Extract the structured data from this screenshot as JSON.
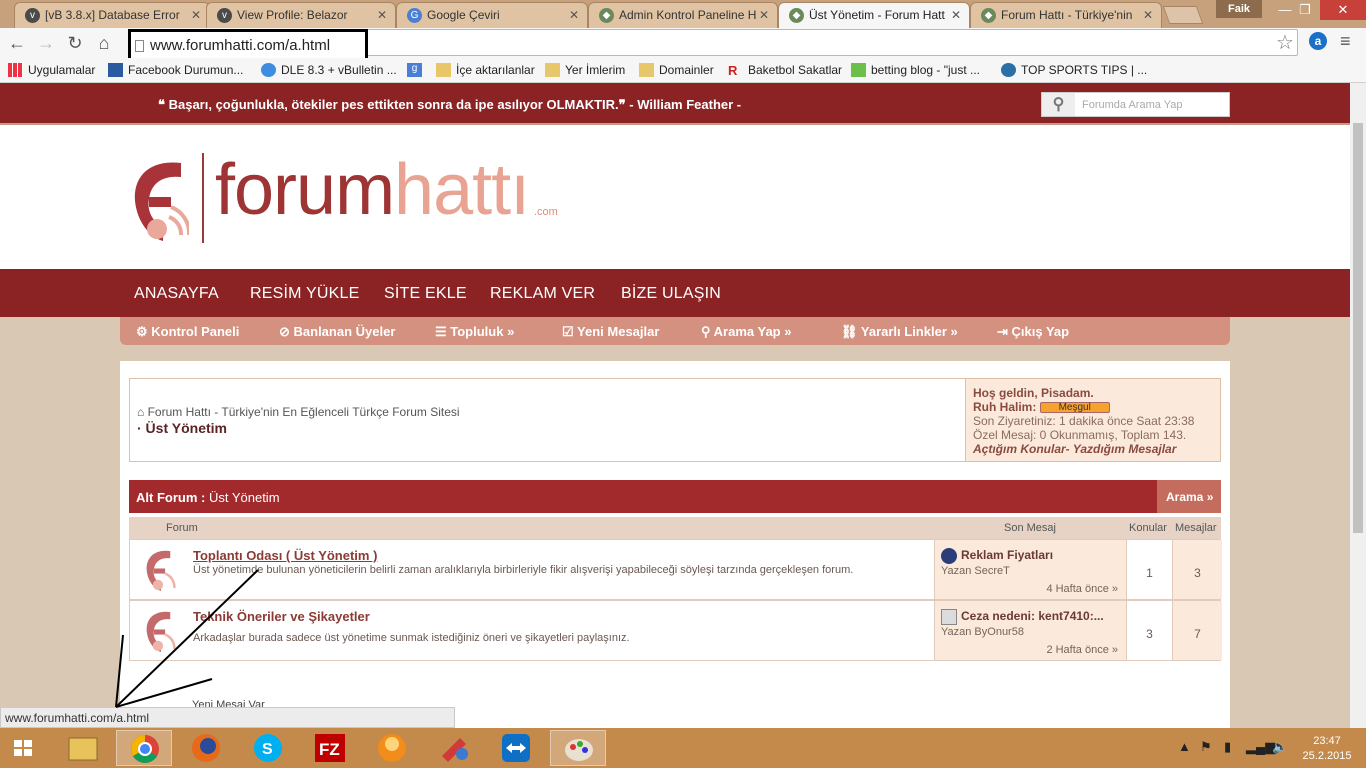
{
  "browser": {
    "tabs": [
      {
        "title": "[vB 3.8.x] Database Error",
        "active": false
      },
      {
        "title": "View Profile: Belazor",
        "active": false
      },
      {
        "title": "Google Çeviri",
        "active": false
      },
      {
        "title": "Admin Kontrol Paneline H",
        "active": false
      },
      {
        "title": "Üst Yönetim - Forum Hatt",
        "active": true
      },
      {
        "title": "Forum Hattı - Türkiye'nin",
        "active": false
      }
    ],
    "user_badge": "Faik",
    "url": "www.forumhatti.com/a.html",
    "bookmarks": [
      {
        "label": "Uygulamalar",
        "icon": "apps-grid-icon"
      },
      {
        "label": "Facebook Durumun...",
        "icon": "bookmark-page-icon"
      },
      {
        "label": "DLE 8.3 + vBulletin ...",
        "icon": "bookmark-page-icon"
      },
      {
        "label": "",
        "icon": "google-icon"
      },
      {
        "label": "İçe aktarılanlar",
        "icon": "folder-icon"
      },
      {
        "label": "Yer İmlerim",
        "icon": "folder-icon"
      },
      {
        "label": "Domainler",
        "icon": "folder-icon"
      },
      {
        "label": "Baketbol Sakatlar",
        "icon": "bookmark-page-icon"
      },
      {
        "label": "betting blog - \"just ...",
        "icon": "bookmark-page-icon"
      },
      {
        "label": "TOP SPORTS TIPS | ...",
        "icon": "wordpress-icon"
      }
    ],
    "status_url": "www.forumhatti.com/a.html"
  },
  "site": {
    "quote": "❝ Başarı, çoğunlukla, ötekiler pes ettikten sonra da ipe asılıyor OLMAKTIR.❞ - William Feather -",
    "search_placeholder": "Forumda Arama Yap",
    "logo_forum": "forum",
    "logo_hatti": "hattı",
    "logo_com": ".com",
    "main_nav": [
      "ANASAYFA",
      "RESİM YÜKLE",
      "SİTE EKLE",
      "REKLAM VER",
      "BİZE ULAŞIN"
    ],
    "sub_nav": [
      {
        "label": "⚙ Kontrol Paneli"
      },
      {
        "label": "⊘ Banlanan Üyeler"
      },
      {
        "label": "☰ Topluluk »"
      },
      {
        "label": "☑ Yeni Mesajlar"
      },
      {
        "label": "⚲ Arama Yap »"
      },
      {
        "label": "⛓ Yararlı Linkler »"
      },
      {
        "label": "⇥ Çıkış Yap"
      }
    ],
    "breadcrumb_root": "Forum Hattı - Türkiye'nin En Eğlenceli Türkçe Forum Sitesi",
    "breadcrumb_current": "· Üst Yönetim",
    "welcome": {
      "greeting": "Hoş geldin, Pisadam.",
      "mood_label": "Ruh Halim:",
      "mood_value": "Meşgul",
      "last_visit": "Son Ziyaretiniz: 1 dakika önce Saat 23:38",
      "pm": "Özel Mesaj: 0 Okunmamış, Toplam 143.",
      "links": "Açtığım Konular- Yazdığım Mesajlar"
    },
    "subforum_header_bold": "Alt Forum :",
    "subforum_header_name": "Üst Yönetim",
    "arama_label": "Arama »",
    "columns": {
      "forum": "Forum",
      "last_post": "Son Mesaj",
      "topics": "Konular",
      "posts": "Mesajlar"
    },
    "forums": [
      {
        "title": "Toplantı Odası ( Üst Yönetim )",
        "desc": "Üst yönetimde bulunan yöneticilerin belirli zaman aralıklarıyla birbirleriyle fikir alışverişi yapabileceği söyleşi tarzında gerçekleşen forum.",
        "last_title": "Reklam Fiyatları",
        "last_by": "Yazan SecreT",
        "last_ago": "4 Hafta önce »",
        "topics": "1",
        "posts": "3"
      },
      {
        "title": "Teknik Öneriler ve Şikayetler",
        "desc": "Arkadaşlar burada sadece üst yönetime sunmak istediğiniz öneri ve şikayetleri paylaşınız.",
        "last_title": "Ceza nedeni: kent7410:...",
        "last_by": "Yazan ByOnur58",
        "last_ago": "2 Hafta önce »",
        "topics": "3",
        "posts": "7"
      }
    ],
    "legend_new": "Yeni Mesaj Var"
  },
  "taskbar": {
    "time": "23:47",
    "date": "25.2.2015"
  },
  "colors": {
    "brand_dark_red": "#8b2325",
    "forum_header_red": "#a32a2c",
    "subnav_pink": "#d49180",
    "accent_peach": "#fbeadb"
  }
}
